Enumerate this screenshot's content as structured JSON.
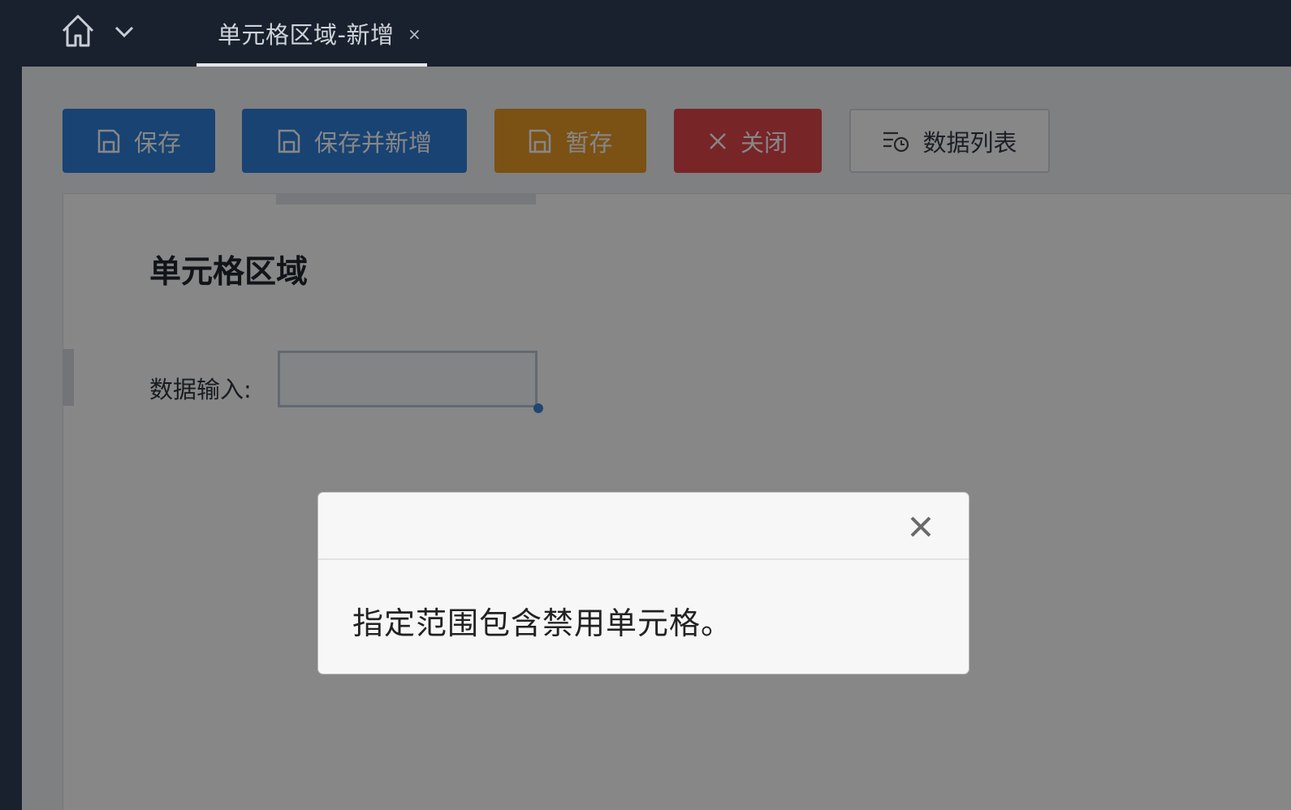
{
  "topbar": {
    "home_icon": "home-icon",
    "menu_icon": "chevron-down-icon",
    "tab": {
      "label": "单元格区域-新增",
      "close": "×"
    }
  },
  "toolbar": {
    "save_label": "保存",
    "save_new_label": "保存并新增",
    "draft_label": "暂存",
    "close_label": "关闭",
    "list_label": "数据列表",
    "colors": {
      "primary": "#2f7fd9",
      "warning": "#e99a27",
      "danger": "#e3474d"
    }
  },
  "form": {
    "section_title": "单元格区域",
    "data_input_label": "数据输入:",
    "data_input_value": ""
  },
  "dialog": {
    "message": "指定范围包含禁用单元格。",
    "close_icon": "close-icon"
  }
}
